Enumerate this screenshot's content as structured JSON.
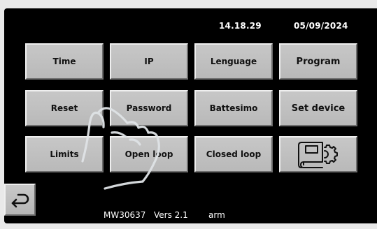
{
  "header": {
    "time": "14.18.29",
    "date": "05/09/2024"
  },
  "menu": {
    "buttons": [
      {
        "label": "Time"
      },
      {
        "label": "IP"
      },
      {
        "label": "Lenguage"
      },
      {
        "label": "Program"
      },
      {
        "label": "Reset"
      },
      {
        "label": "Password"
      },
      {
        "label": "Battesimo"
      },
      {
        "label": "Set device"
      },
      {
        "label": "Limits"
      },
      {
        "label": "Open loop"
      },
      {
        "label": "Closed loop"
      }
    ],
    "manual_settings_icon": "book-gear-icon"
  },
  "footer": {
    "back_icon": "back-arrow-icon",
    "model": "MW30637",
    "version": "Vers 2.1",
    "platform": "arm"
  },
  "overlay": {
    "gesture_icon": "hand-tap-icon"
  }
}
